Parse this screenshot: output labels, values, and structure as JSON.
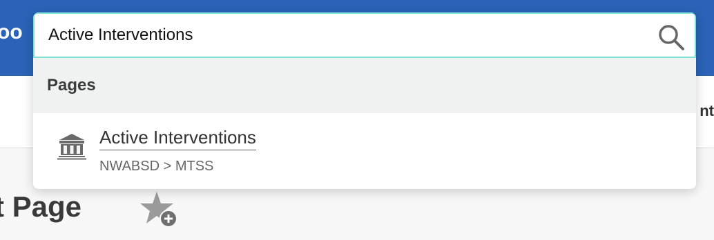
{
  "header": {
    "logo_fragment": "oo"
  },
  "nav": {
    "item_fragment": "nt"
  },
  "page": {
    "title": "t Page"
  },
  "search": {
    "value": "Active Interventions",
    "placeholder": ""
  },
  "results": {
    "section_label": "Pages",
    "items": [
      {
        "title": "Active Interventions",
        "path": "NWABSD > MTSS",
        "icon": "building-icon"
      }
    ]
  },
  "colors": {
    "header_bg": "#2a63b7",
    "search_border": "#7fe0d8",
    "section_bg": "#f0f2f1"
  },
  "icons": {
    "search": "search-icon",
    "favorite": "star-add-icon"
  }
}
